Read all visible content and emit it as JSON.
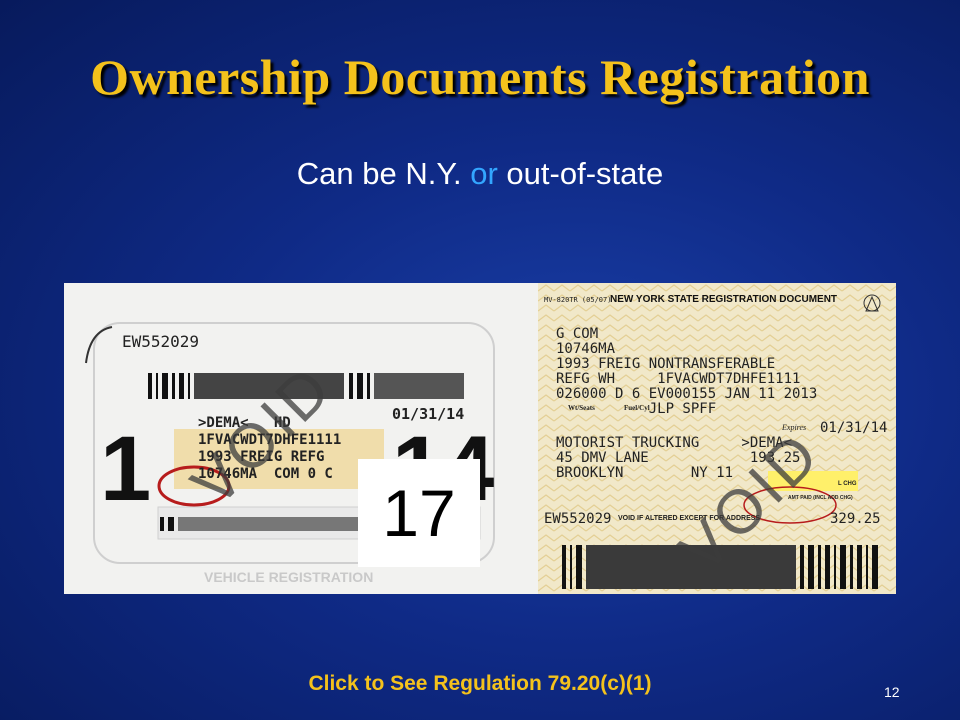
{
  "slide": {
    "title": "Ownership Documents Registration",
    "subtitle_prefix": "Can be N.Y. ",
    "subtitle_highlight": "or",
    "subtitle_suffix": " out-of-state",
    "link_text": "Click to See Regulation 79.20(c)(1)",
    "page_number": "12"
  },
  "left_document": {
    "serial": "EW552029",
    "date": "01/31/14",
    "line1": ">DEMA<   HD",
    "line2": "1FVACWDT7DHFE1111",
    "line3": "1993 FREIG REFG",
    "line4": "10746MA  COM 0 C",
    "big_left": "1",
    "big_right": "14",
    "void_text": "VOID",
    "overlay_number": "17",
    "bottom_text": "VEHICLE REGISTRATION"
  },
  "right_document": {
    "form_code": "MV-820TR (05/07)",
    "header": "NEW YORK STATE REGISTRATION DOCUMENT",
    "lines": [
      "G COM",
      "10746MA",
      "1993 FREIG NONTRANSFERABLE",
      "REFG WH     1FVACWDT7DHFE1111",
      "026000 D 6 EV000155 JAN 11 2013",
      "           JLP SPFF"
    ],
    "small_labels": [
      "Wt/Seats",
      "Fuel/Cyl"
    ],
    "expires_label": "Expires",
    "expires_date": "01/31/14",
    "owner_lines": [
      "MOTORIST TRUCKING     >DEMA<",
      "45 DMV LANE            193.25",
      "BROOKLYN        NY 11"
    ],
    "fee_label": "AMT PAID (INCL ADD CHG)",
    "chg_label": "L CHG",
    "serial": "EW552029",
    "altered_text": "VOID IF ALTERED EXCEPT FOR ADDRESS",
    "total": "329.25",
    "void_text": "VOID"
  }
}
